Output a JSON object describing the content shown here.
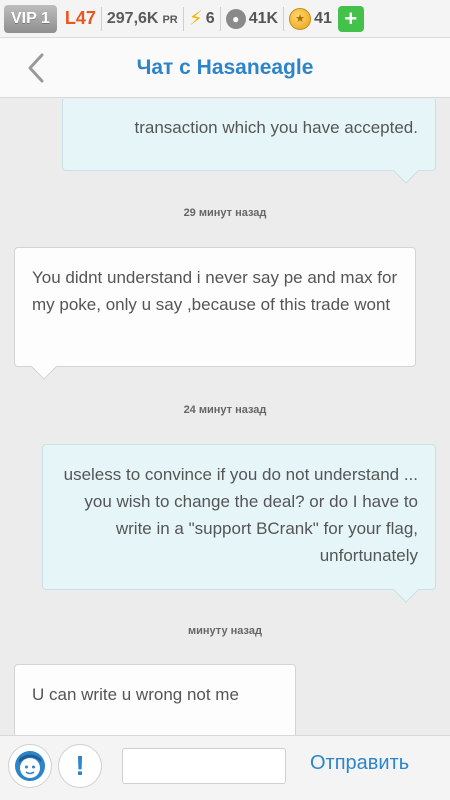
{
  "statusbar": {
    "vip_label": "VIP 1",
    "level": "L47",
    "pr_value": "297,6K",
    "pr_unit": "PR",
    "energy": "6",
    "pokemon_count": "41K",
    "coins": "41",
    "add_label": "+"
  },
  "header": {
    "title": "Чат с Hasaneagle"
  },
  "messages": [
    {
      "text": "transaction which you have accepted.",
      "side": "mine"
    },
    {
      "timestamp": "29 минут назад"
    },
    {
      "text": "You didnt understand i never say pe and max for my poke, only u say ,because of this trade wont",
      "side": "theirs"
    },
    {
      "timestamp": "24 минут назад"
    },
    {
      "text": "useless to convince if you do not understand ... you wish to change the deal? or do I have to write in a \"support BCrank\" for your flag, unfortunately",
      "side": "mine"
    },
    {
      "timestamp": "минуту назад"
    },
    {
      "text": "U can write u wrong not me",
      "side": "theirs"
    }
  ],
  "composer": {
    "input_value": "",
    "input_placeholder": "",
    "send_label": "Отправить"
  },
  "colors": {
    "accent": "#2d84c8",
    "level": "#e8571f",
    "my_bubble": "#e6f6f8",
    "their_bubble": "#fdfdfd",
    "plus_button": "#43c14a"
  }
}
